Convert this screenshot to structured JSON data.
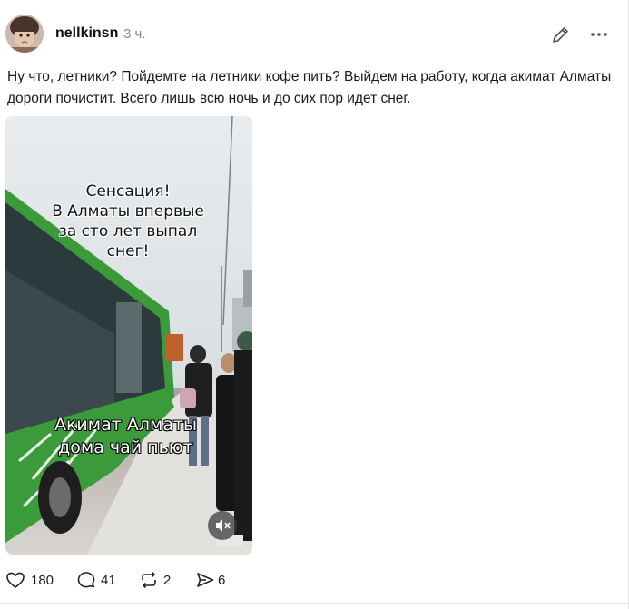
{
  "post": {
    "author": "nellkinsn",
    "time": "3 ч.",
    "text": "Ну что, летники? Пойдемте на летники кофе пить? Выйдем на работу, когда акимат Алматы дороги почистит. Всего лишь всю ночь и до сих пор идет снег.",
    "media": {
      "caption_top": "Сенсация!\nВ Алматы впервые\nза сто лет выпал\nснег!",
      "caption_bottom": "Акимат Алматы\nдома чай пьют",
      "mute_icon": "volume-muted-icon"
    }
  },
  "actions": {
    "likes": "180",
    "comments": "41",
    "reposts": "2",
    "shares": "6"
  },
  "icons": {
    "edit": "pencil-icon",
    "more": "more-horizontal-icon",
    "like": "heart-icon",
    "comment": "comment-bubble-icon",
    "repost": "repost-icon",
    "share": "send-icon"
  },
  "colors": {
    "bus_green": "#3b9a3a",
    "muted_text": "#8a8a8a"
  }
}
